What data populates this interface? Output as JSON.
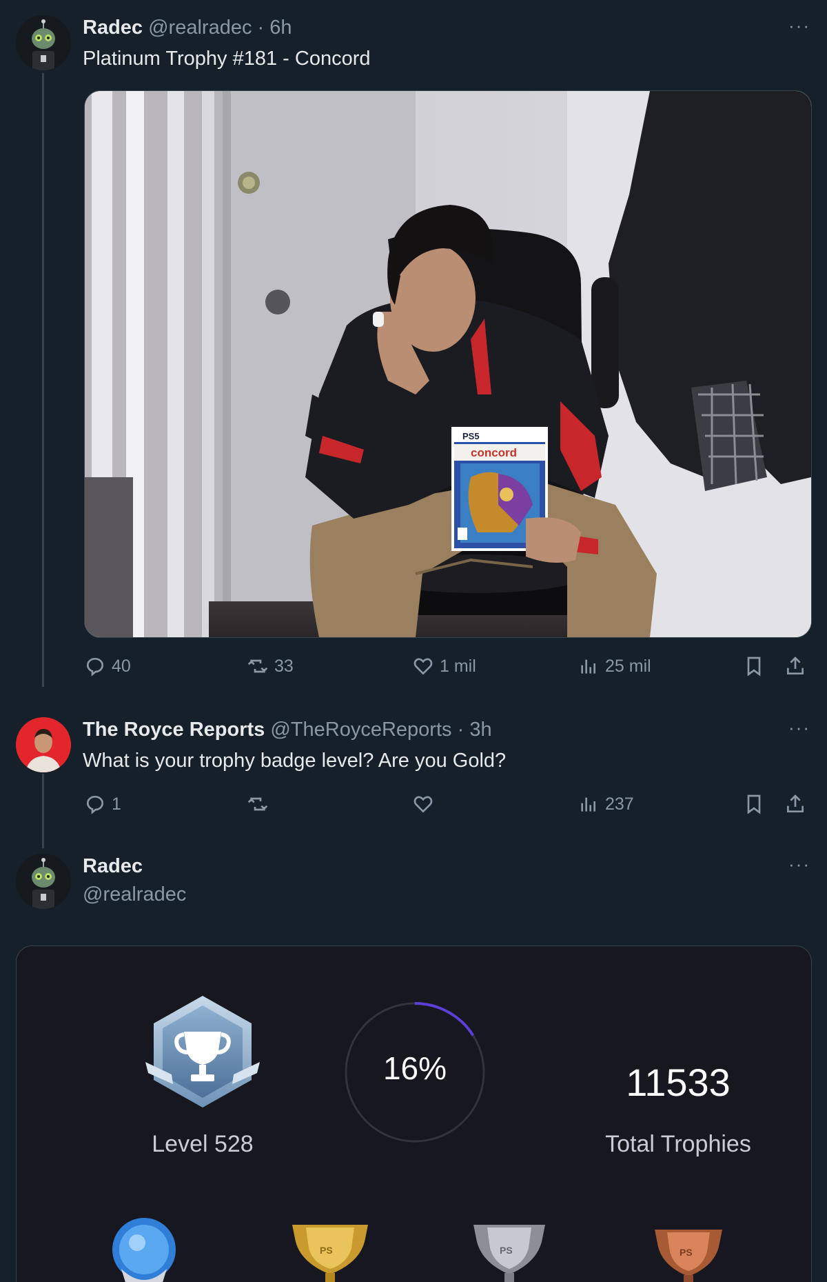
{
  "tweet1": {
    "name": "Radec",
    "handle": "@realradec",
    "dot": "·",
    "time": "6h",
    "text": "Platinum Trophy #181 - Concord",
    "replies": "40",
    "retweets": "33",
    "likes": "1 mil",
    "views": "25 mil",
    "media": {
      "box_brand": "PS5",
      "box_title": "concord"
    }
  },
  "tweet2": {
    "name": "The Royce Reports",
    "handle": "@TheRoyceReports",
    "dot": "·",
    "time": "3h",
    "text": "What is your trophy badge level? Are you Gold?",
    "replies": "1",
    "retweets": "",
    "likes": "",
    "views": "237"
  },
  "tweet3": {
    "name": "Radec",
    "handle": "@realradec"
  },
  "more_label": "···",
  "trophy_card": {
    "level_label": "Level 528",
    "progress_label": "16%",
    "progress": 0.16,
    "total": "11533",
    "total_label": "Total Trophies",
    "trophy_marks": [
      "PS",
      "PS",
      "PS"
    ]
  },
  "colors": {
    "background": "#15202b",
    "card_bg": "#17171f",
    "progress_accent": "#5b3fd6",
    "muted": "#8b98a5"
  }
}
